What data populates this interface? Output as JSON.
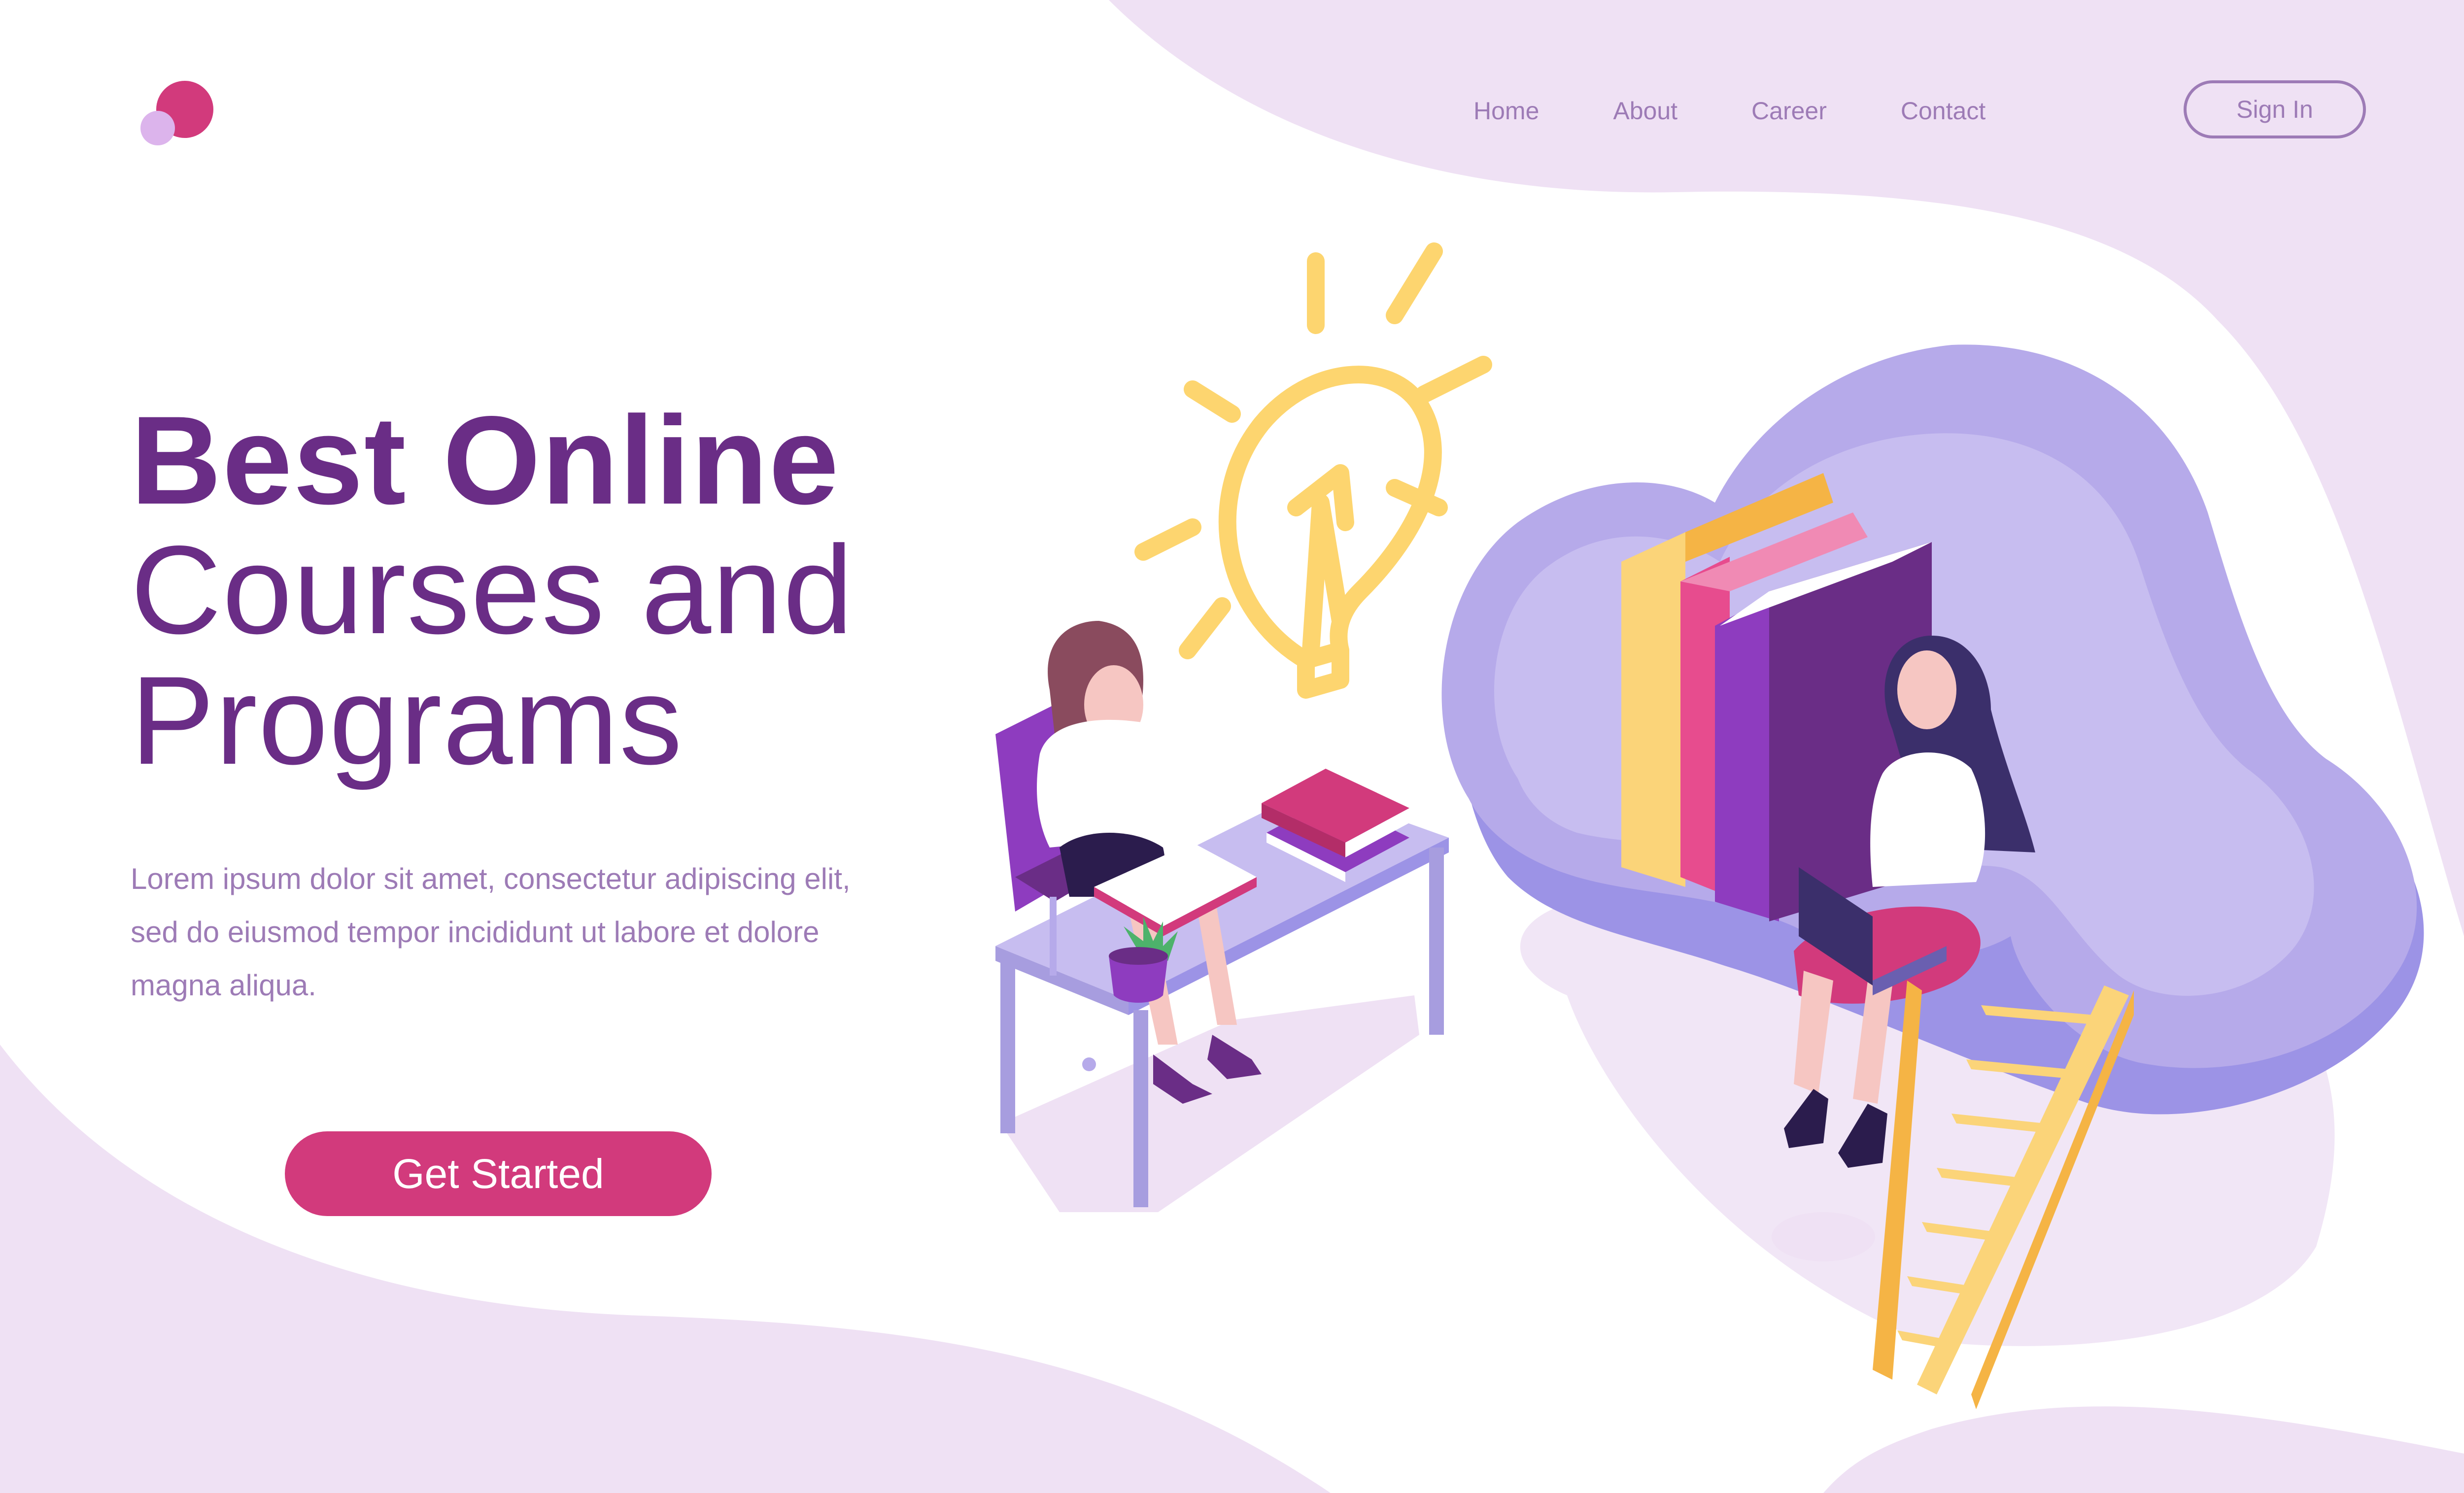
{
  "nav": {
    "items": [
      {
        "label": "Home"
      },
      {
        "label": "About"
      },
      {
        "label": "Career"
      },
      {
        "label": "Contact"
      }
    ],
    "signin_label": "Sign In"
  },
  "hero": {
    "title_line1": "Best Online",
    "title_line2": "Courses and",
    "title_line3": "Programs",
    "body_line1": "Lorem ipsum dolor sit amet, consectetur adipiscing elit,",
    "body_line2": "sed do eiusmod tempor incididunt ut labore et dolore",
    "body_line3": "magna aliqua.",
    "cta_label": "Get Started"
  },
  "colors": {
    "primary": "#6a2d86",
    "accent": "#d23a7c",
    "nav_text": "#9d7bb6",
    "blob": "#efe1f4",
    "cloud": "#b6aaea"
  }
}
